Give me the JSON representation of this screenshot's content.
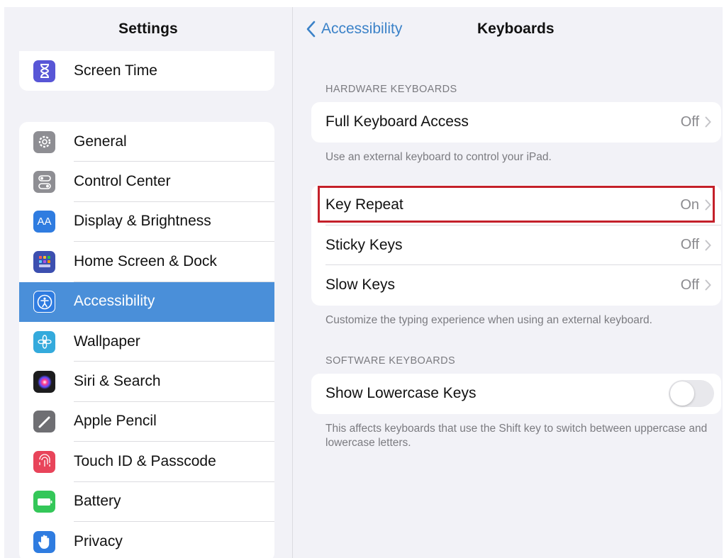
{
  "sidebar": {
    "title": "Settings",
    "top_items": [
      {
        "label": "Screen Time",
        "icon": "hourglass-icon",
        "color": "#5856d6"
      }
    ],
    "items": [
      {
        "label": "General",
        "icon": "gear-icon",
        "color": "#8e8e93"
      },
      {
        "label": "Control Center",
        "icon": "toggles-icon",
        "color": "#8e8e93"
      },
      {
        "label": "Display & Brightness",
        "icon": "text-size-icon",
        "color": "#2f7ce0"
      },
      {
        "label": "Home Screen & Dock",
        "icon": "app-grid-icon",
        "color": "#3c4fb0"
      },
      {
        "label": "Accessibility",
        "icon": "accessibility-icon",
        "color": "#2f7ce0",
        "selected": true
      },
      {
        "label": "Wallpaper",
        "icon": "flower-icon",
        "color": "#34aadc"
      },
      {
        "label": "Siri & Search",
        "icon": "siri-icon",
        "color": "#222222"
      },
      {
        "label": "Apple Pencil",
        "icon": "pencil-icon",
        "color": "#6f6f73"
      },
      {
        "label": "Touch ID & Passcode",
        "icon": "fingerprint-icon",
        "color": "#e8445a"
      },
      {
        "label": "Battery",
        "icon": "battery-icon",
        "color": "#34c759"
      },
      {
        "label": "Privacy",
        "icon": "hand-icon",
        "color": "#2f7ce0"
      }
    ]
  },
  "nav": {
    "back_label": "Accessibility",
    "title": "Keyboards"
  },
  "hardware": {
    "header": "HARDWARE KEYBOARDS",
    "full_access": {
      "label": "Full Keyboard Access",
      "value": "Off"
    },
    "full_access_footer": "Use an external keyboard to control your iPad.",
    "rows": [
      {
        "label": "Key Repeat",
        "value": "On"
      },
      {
        "label": "Sticky Keys",
        "value": "Off"
      },
      {
        "label": "Slow Keys",
        "value": "Off"
      }
    ],
    "rows_footer": "Customize the typing experience when using an external keyboard."
  },
  "software": {
    "header": "SOFTWARE KEYBOARDS",
    "lowercase": {
      "label": "Show Lowercase Keys",
      "on": false
    },
    "footer": "This affects keyboards that use the Shift key to switch between uppercase and lowercase letters."
  },
  "colors": {
    "accent": "#3b82c8",
    "selection": "#4a8fd9",
    "highlight_border": "#c4202a"
  }
}
